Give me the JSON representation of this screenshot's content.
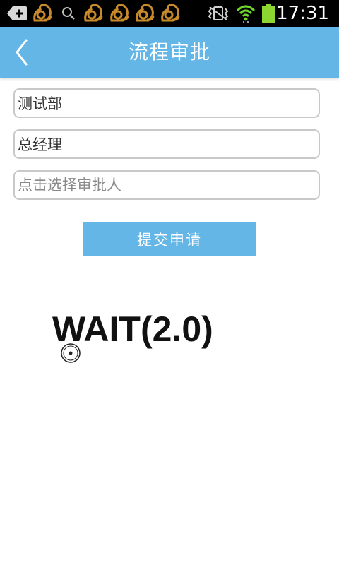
{
  "status_bar": {
    "time": "17:31",
    "left_icons": [
      "add-box-icon",
      "squirrel-app-icon",
      "search-icon",
      "squirrel-app-icon",
      "squirrel-app-icon",
      "squirrel-app-icon",
      "squirrel-app-icon"
    ],
    "right_icons": [
      "vibrate-icon",
      "wifi-icon",
      "battery-icon"
    ]
  },
  "header": {
    "title": "流程审批",
    "back_icon": "chevron-left-icon",
    "color": "#63b6e6"
  },
  "form": {
    "department": {
      "value": "测试部"
    },
    "position": {
      "value": "总经理"
    },
    "approver": {
      "value": "",
      "placeholder": "点击选择审批人"
    },
    "submit_label": "提交申请"
  },
  "overlay": {
    "text": "WAIT(2.0)"
  },
  "colors": {
    "accent": "#63b6e6",
    "wifi": "#6ed32d",
    "battery": "#8bd631"
  }
}
